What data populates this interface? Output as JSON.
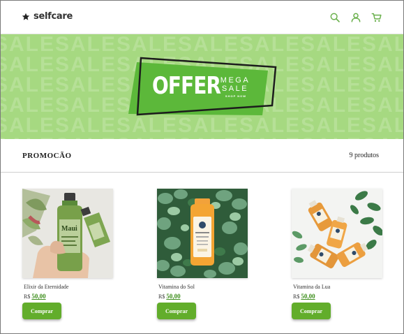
{
  "header": {
    "logo_text": "selfcare",
    "icons": [
      "search-icon",
      "user-icon",
      "cart-icon"
    ],
    "accent_color": "#6ab04c"
  },
  "banner": {
    "background_word": "SALE",
    "offer_text": "OFFER",
    "mega_text": "MEGA",
    "sale_text": "SALE",
    "shop_now_text": "SHOP NOW",
    "background_color": "#a6d981",
    "badge_color": "#5cb83a"
  },
  "section": {
    "title": "PROMOCÃO",
    "count": "9 produtos"
  },
  "products": [
    {
      "name": "Elixir da Eternidade",
      "currency": "R$",
      "price": "50,00",
      "button": "Comprar"
    },
    {
      "name": "Vitamina do Sol",
      "currency": "R$",
      "price": "50,00",
      "button": "Comprar"
    },
    {
      "name": "Vitamina da Lua",
      "currency": "R$",
      "price": "50,00",
      "button": "Comprar"
    }
  ],
  "colors": {
    "button": "#62ad2b",
    "price": "#3f8f1e"
  }
}
